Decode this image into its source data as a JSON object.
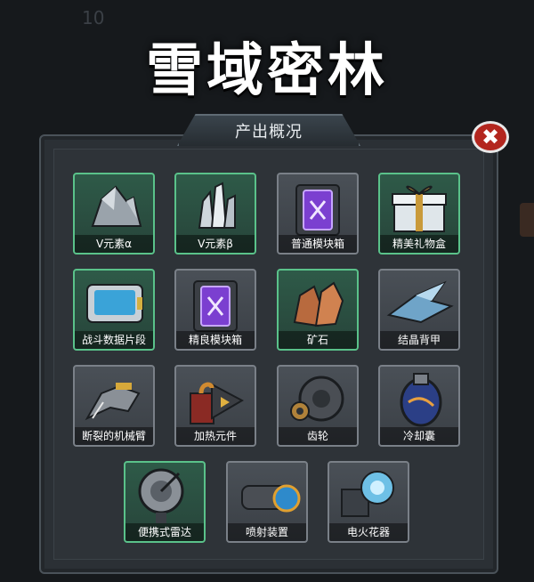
{
  "background": {
    "corner_text": "10",
    "subtitle_text": ""
  },
  "title": "雪域密林",
  "panel": {
    "header": "产出概况",
    "close_symbol": "✖"
  },
  "items": [
    {
      "name": "V元素α",
      "icon": "gray-rock-icon",
      "rarity": "green"
    },
    {
      "name": "V元素β",
      "icon": "crystal-cluster-icon",
      "rarity": "green"
    },
    {
      "name": "普通模块箱",
      "icon": "purple-module-box-icon",
      "rarity": "gray"
    },
    {
      "name": "精美礼物盒",
      "icon": "gift-box-icon",
      "rarity": "green"
    },
    {
      "name": "战斗数据片段",
      "icon": "data-card-icon",
      "rarity": "green"
    },
    {
      "name": "精良模块箱",
      "icon": "purple-module-box-icon",
      "rarity": "gray"
    },
    {
      "name": "矿石",
      "icon": "ore-icon",
      "rarity": "green"
    },
    {
      "name": "结晶背甲",
      "icon": "crystal-armor-icon",
      "rarity": "gray"
    },
    {
      "name": "断裂的机械臂",
      "icon": "broken-mech-arm-icon",
      "rarity": "gray"
    },
    {
      "name": "加热元件",
      "icon": "heating-element-icon",
      "rarity": "gray"
    },
    {
      "name": "齿轮",
      "icon": "gear-icon",
      "rarity": "gray"
    },
    {
      "name": "冷却囊",
      "icon": "cooling-capsule-icon",
      "rarity": "gray"
    },
    {
      "name": "便携式雷达",
      "icon": "radar-icon",
      "rarity": "green"
    },
    {
      "name": "喷射装置",
      "icon": "jet-device-icon",
      "rarity": "gray"
    },
    {
      "name": "电火花器",
      "icon": "spark-device-icon",
      "rarity": "gray"
    }
  ]
}
